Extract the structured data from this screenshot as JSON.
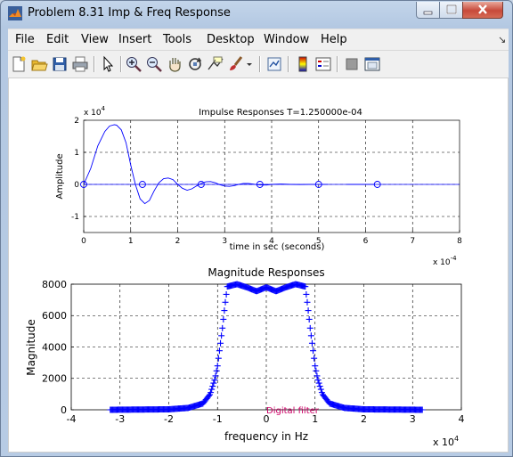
{
  "window": {
    "title": "Problem 8.31 Imp & Freq Response"
  },
  "menubar": {
    "items": [
      "File",
      "Edit",
      "View",
      "Insert",
      "Tools",
      "Desktop",
      "Window",
      "Help"
    ]
  },
  "toolbar": {
    "icons": [
      "new-figure-icon",
      "open-file-icon",
      "save-icon",
      "print-icon",
      "pointer-icon",
      "zoom-in-icon",
      "zoom-out-icon",
      "pan-icon",
      "rotate-3d-icon",
      "data-cursor-icon",
      "brush-icon",
      "link-plot-icon",
      "colorbar-icon",
      "legend-icon",
      "hide-plot-tools-icon",
      "show-plot-tools-icon"
    ]
  },
  "colors": {
    "plot": "#0000ff",
    "overlay_text": "#cc0066"
  },
  "chart_data": [
    {
      "type": "line",
      "title": "Impulse Responses T=1.250000e-04",
      "xlabel": "time in sec (seconds)",
      "ylabel": "Amplitude",
      "x_exponent": "x 10",
      "x_exponent_power": "-4",
      "y_exponent": "x 10",
      "y_exponent_power": "4",
      "xlim": [
        0,
        8
      ],
      "ylim": [
        -1.5,
        2
      ],
      "xticks": [
        "0",
        "1",
        "2",
        "3",
        "4",
        "5",
        "6",
        "7",
        "8"
      ],
      "yticks": [
        "-1",
        "0",
        "1",
        "2"
      ],
      "grid": true,
      "series": [
        {
          "x": [
            0,
            0.15,
            0.3,
            0.45,
            0.55,
            0.65,
            0.7,
            0.8,
            0.9,
            1.0,
            1.1,
            1.2,
            1.3,
            1.4,
            1.5,
            1.6,
            1.7,
            1.8,
            1.9,
            2.0,
            2.1,
            2.2,
            2.3,
            2.4,
            2.5,
            2.6,
            2.7,
            2.8,
            2.9,
            3.0,
            3.1,
            3.2,
            3.3,
            3.4,
            3.5,
            3.6,
            3.7,
            3.8,
            3.9,
            4.0,
            4.2,
            4.4,
            4.6,
            4.8,
            5.0,
            5.2
          ],
          "y": [
            0,
            0.5,
            1.2,
            1.65,
            1.82,
            1.86,
            1.85,
            1.7,
            1.3,
            0.6,
            0.0,
            -0.45,
            -0.6,
            -0.5,
            -0.2,
            0.05,
            0.18,
            0.2,
            0.15,
            0.0,
            -0.12,
            -0.18,
            -0.14,
            -0.05,
            0.03,
            0.08,
            0.09,
            0.05,
            -0.01,
            -0.05,
            -0.06,
            -0.04,
            0.0,
            0.03,
            0.03,
            0.01,
            -0.01,
            -0.02,
            -0.02,
            0.0,
            0.01,
            0.0,
            -0.005,
            0.0,
            0.0,
            0.0
          ]
        },
        {
          "x": [
            5.6,
            6.2
          ],
          "y": [
            0,
            0
          ]
        }
      ],
      "sample_markers": {
        "x": [
          0,
          1.25,
          2.5,
          3.75,
          5.0,
          6.25
        ],
        "y": [
          0,
          0,
          0,
          0,
          0,
          0
        ]
      }
    },
    {
      "type": "scatter",
      "title": "Magnitude Responses",
      "xlabel": "frequency in Hz",
      "ylabel": "Magnitude",
      "x_exponent": "x 10",
      "x_exponent_power": "4",
      "xlim": [
        -4,
        4
      ],
      "ylim": [
        0,
        8000
      ],
      "xticks": [
        "-4",
        "-3",
        "-2",
        "-1",
        "0",
        "1",
        "2",
        "3",
        "4"
      ],
      "yticks": [
        "0",
        "2000",
        "4000",
        "6000",
        "8000"
      ],
      "grid": true,
      "marker": "+",
      "annotation": "Digital filter",
      "passband_ripple": {
        "x": [
          -0.8,
          -0.6,
          -0.4,
          -0.2,
          0,
          0.2,
          0.4,
          0.6,
          0.8
        ],
        "y": [
          7850,
          8000,
          7800,
          7550,
          7800,
          7550,
          7800,
          8000,
          7850
        ]
      },
      "edges": {
        "x": [
          -3.2,
          -2.0,
          -1.6,
          -1.3,
          -1.15,
          -1.05,
          -1.0,
          -0.95,
          -0.9,
          -0.85,
          -0.8
        ],
        "y": [
          0,
          30,
          120,
          400,
          1000,
          2000,
          2800,
          4000,
          5200,
          6600,
          7850
        ]
      }
    }
  ]
}
